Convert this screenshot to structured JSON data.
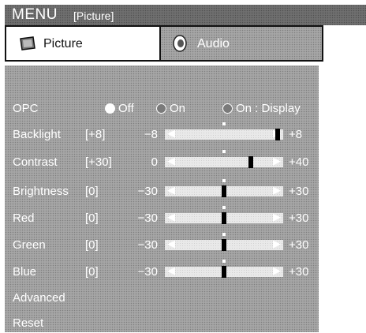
{
  "header": {
    "menu": "MENU",
    "section": "[Picture]"
  },
  "tabs": [
    {
      "label": "Picture",
      "icon": "picture-icon",
      "active": true
    },
    {
      "label": "Audio",
      "icon": "speaker-icon",
      "active": false
    }
  ],
  "opc": {
    "label": "OPC",
    "options": [
      {
        "label": "Off",
        "selected": true
      },
      {
        "label": "On",
        "selected": false
      },
      {
        "label": "On : Display",
        "selected": false
      }
    ]
  },
  "sliders": [
    {
      "name": "Backlight",
      "current": "[+8]",
      "min_label": "−8",
      "max_label": "+8",
      "min": -8,
      "max": 8,
      "value": 8
    },
    {
      "name": "Contrast",
      "current": "[+30]",
      "min_label": "0",
      "max_label": "+40",
      "min": 0,
      "max": 40,
      "value": 30
    },
    {
      "name": "Brightness",
      "current": "[0]",
      "min_label": "−30",
      "max_label": "+30",
      "min": -30,
      "max": 30,
      "value": 0
    },
    {
      "name": "Red",
      "current": "[0]",
      "min_label": "−30",
      "max_label": "+30",
      "min": -30,
      "max": 30,
      "value": 0
    },
    {
      "name": "Green",
      "current": "[0]",
      "min_label": "−30",
      "max_label": "+30",
      "min": -30,
      "max": 30,
      "value": 0
    },
    {
      "name": "Blue",
      "current": "[0]",
      "min_label": "−30",
      "max_label": "+30",
      "min": -30,
      "max": 30,
      "value": 0
    }
  ],
  "menu_items": [
    {
      "label": "Advanced"
    },
    {
      "label": "Reset"
    }
  ]
}
